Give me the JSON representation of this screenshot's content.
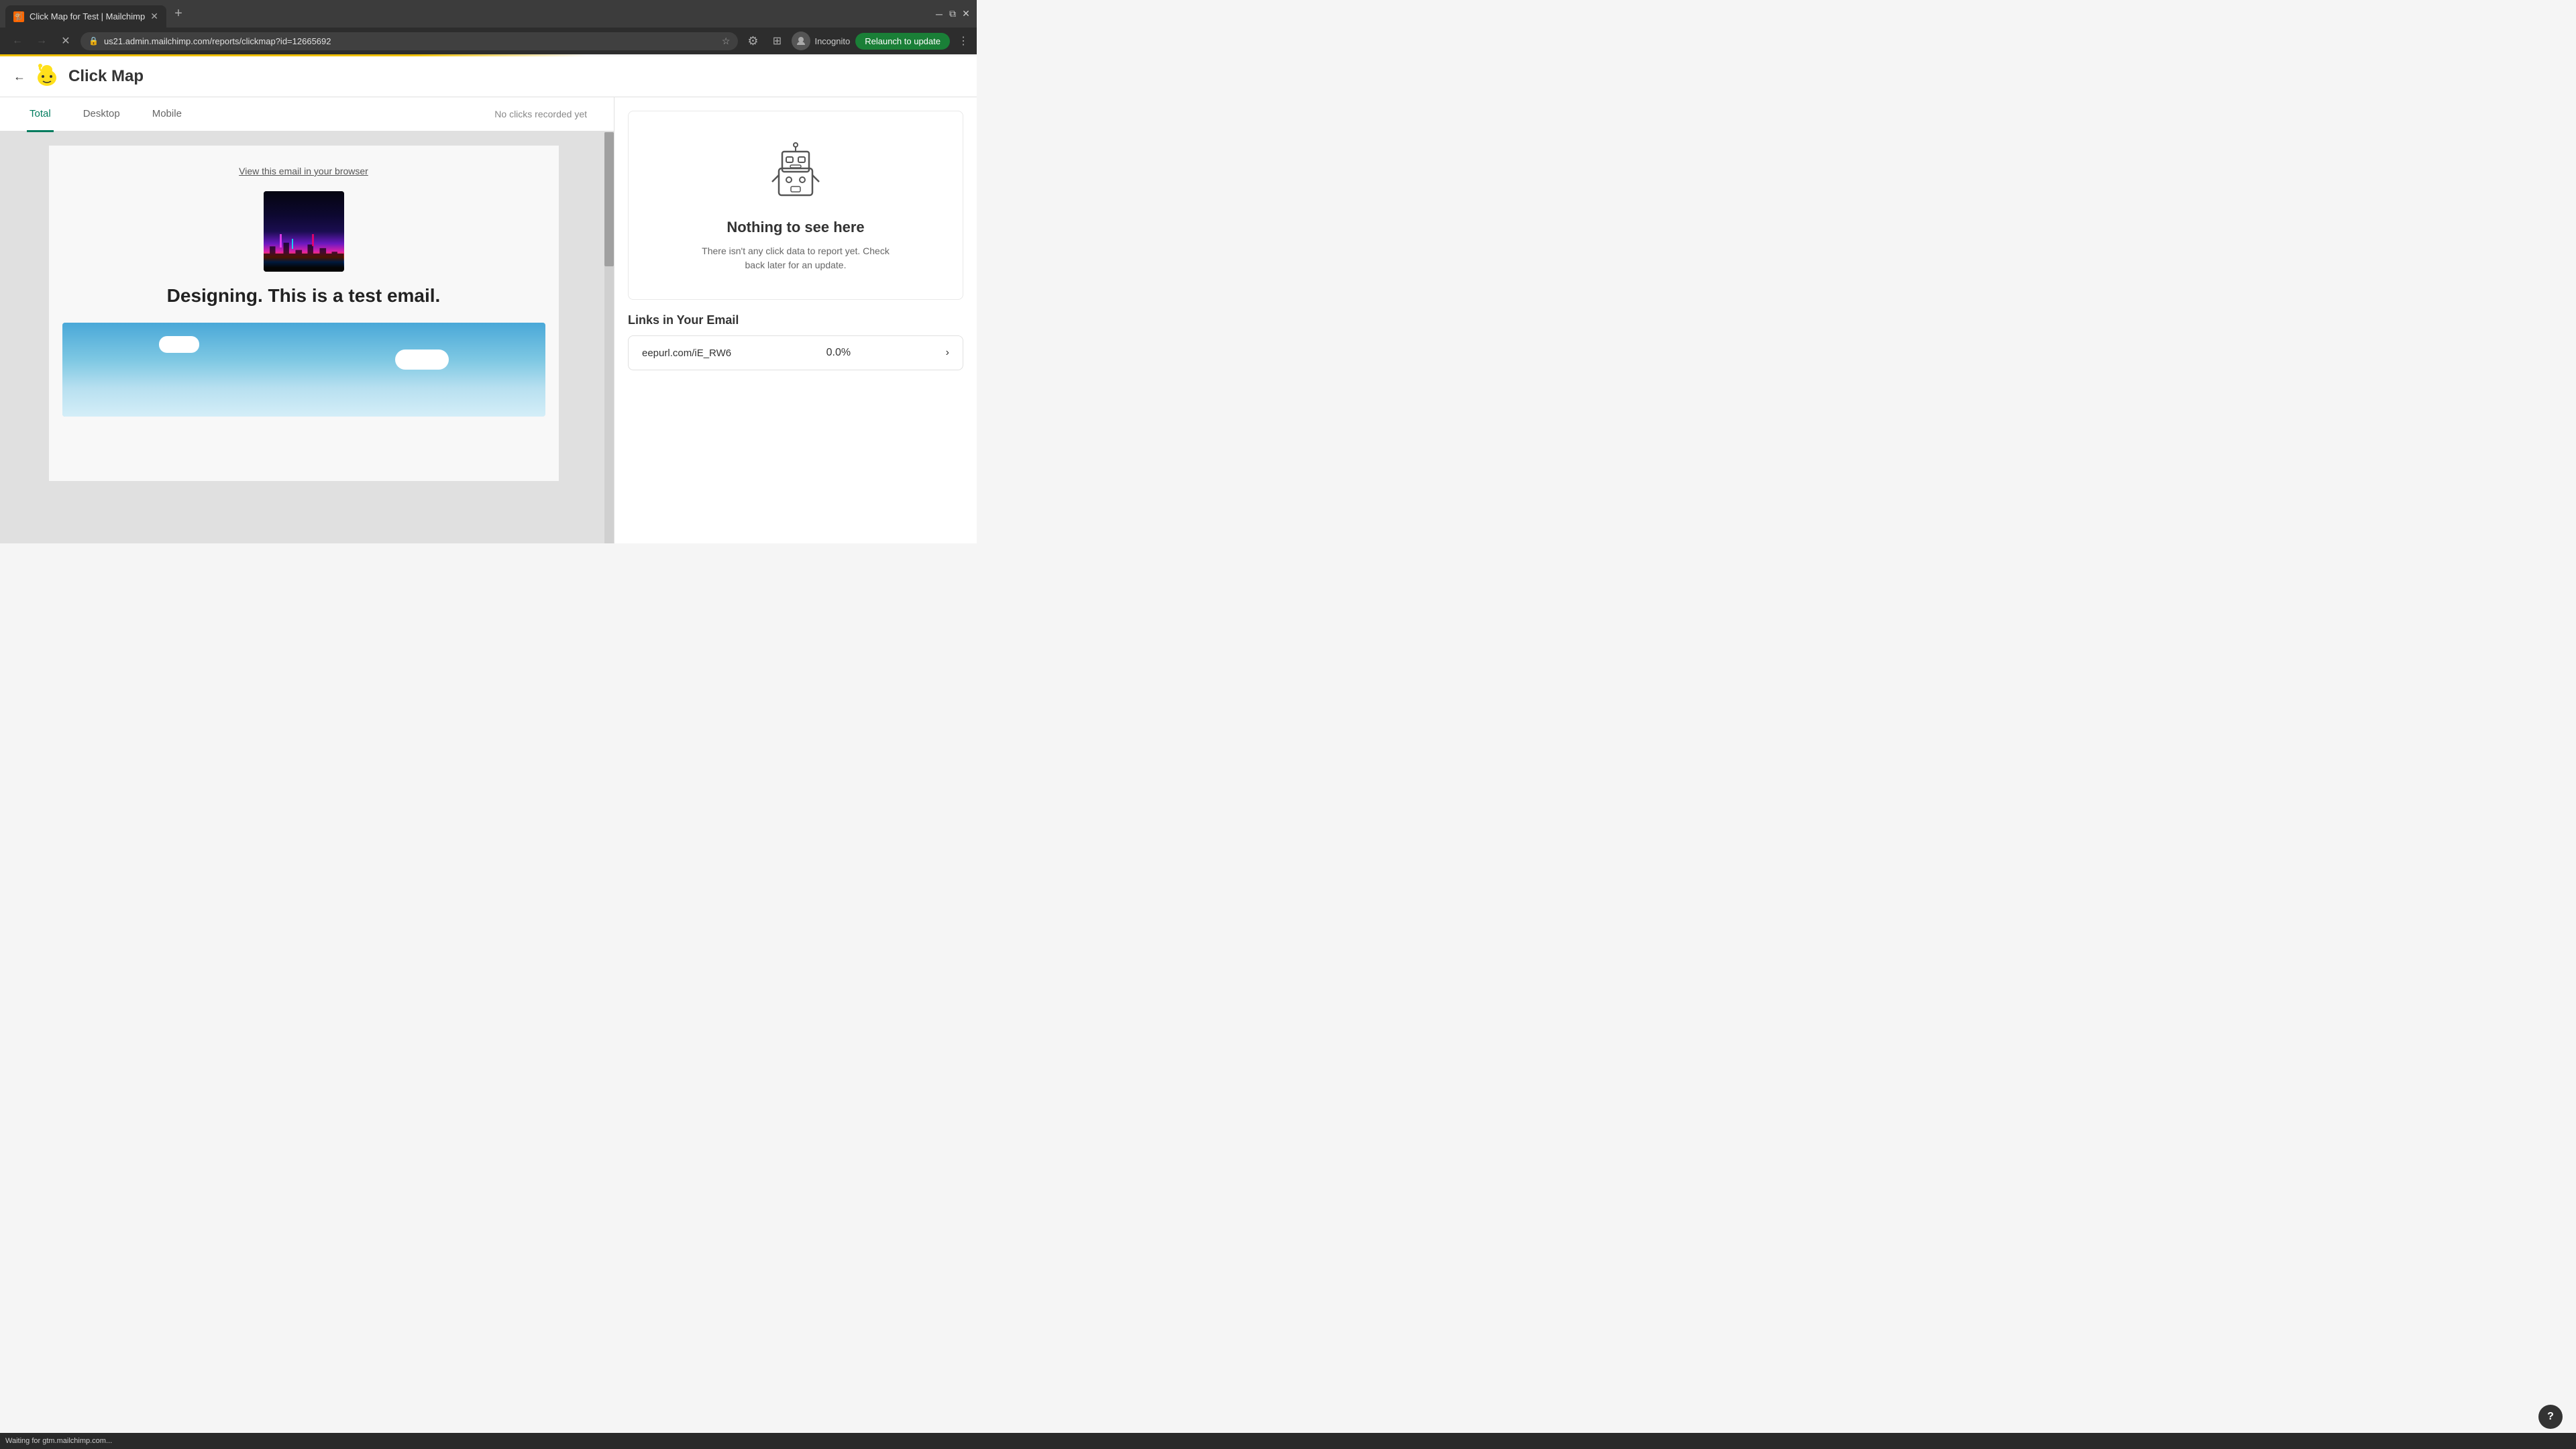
{
  "browser": {
    "tab_title": "Click Map for Test | Mailchimp",
    "tab_favicon": "🐒",
    "new_tab_label": "+",
    "address": "us21.admin.mailchimp.com/reports/clickmap?id=12665692",
    "incognito_label": "Incognito",
    "relaunch_label": "Relaunch to update"
  },
  "header": {
    "back_label": "←",
    "page_title": "Click Map"
  },
  "tabs": {
    "items": [
      {
        "label": "Total",
        "active": true
      },
      {
        "label": "Desktop",
        "active": false
      },
      {
        "label": "Mobile",
        "active": false
      }
    ],
    "no_clicks_text": "No clicks recorded yet"
  },
  "email_preview": {
    "browser_link_text": "View this email in your browser",
    "heading": "Designing. This is a test email."
  },
  "empty_state": {
    "title": "Nothing to see here",
    "description": "There isn't any click data to report yet. Check back later for an update."
  },
  "links_section": {
    "title": "Links in Your Email",
    "links": [
      {
        "url": "eepurl.com/iE_RW6",
        "percentage": "0.0%"
      }
    ]
  },
  "status_bar": {
    "text": "Waiting for gtm.mailchimp.com..."
  },
  "help_btn_label": "?"
}
